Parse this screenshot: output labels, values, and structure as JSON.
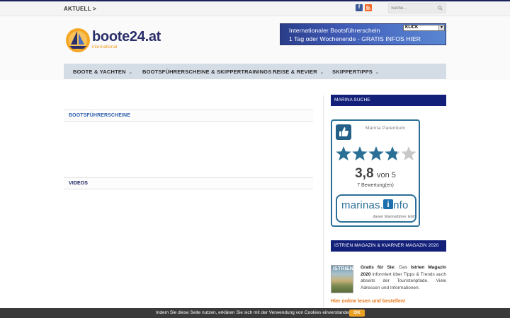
{
  "topbar": {
    "label": "AKTUELL >",
    "search_placeholder": "Suche...",
    "social": [
      {
        "icon": "facebook-icon",
        "glyph": "f",
        "color": "#3b5998"
      },
      {
        "icon": "rss-icon",
        "glyph": "∷",
        "color": "#f26522"
      }
    ]
  },
  "logo": {
    "title": "boote24.at",
    "subtitle": "international"
  },
  "banner": {
    "line1": "Internationaler Bootsführerschein",
    "line2": "1 Tag oder Wochenende - GRATIS INFOS HIER",
    "button": "KLICK"
  },
  "nav": {
    "items": [
      {
        "label": "BOOTE & YACHTEN"
      },
      {
        "label": "BOOTSFÜHRERSCHEINE & SKIPPERTRAININGS"
      },
      {
        "label": "REISE & REVIER"
      },
      {
        "label": "SKIPPERTIPPS"
      }
    ]
  },
  "main": {
    "sections": [
      {
        "title": "BOOTSFÜHRERSCHEINE",
        "color": "#2e5fae"
      },
      {
        "title": "VIDEOS",
        "color": "#1a2260"
      }
    ]
  },
  "sidebar": {
    "marina_title": "MARINA SUCHE",
    "widget": {
      "marina_name": "Marina Parentium",
      "rating": 3.8,
      "rating_display": "3,8",
      "rating_of": "von 5",
      "stars_max": 5,
      "reviews": "7 Bewertung(en)",
      "brand_text": "marinas.",
      "brand_letter": "i",
      "brand_suffix": "nfo",
      "brand_tagline": "dieser Marinaführer lebt!",
      "accent": "#2b6f98"
    },
    "magazine_title": "ISTRIEN MAGAZIN & KVARNER MAGAZIN 2020",
    "magazine": {
      "cover_label": "ISTRIEN",
      "lead": "Gratis für Sie:",
      "text1": " Das ",
      "bold2": "Istrien Magazin 2020",
      "text2": " informiert über Tipps & Trends auch abseits der Touristenpfade. Viele Adressen und Informationen.",
      "read_more": "Hier online lesen und bestellen!"
    }
  },
  "cookie": {
    "message": "Indem Sie diese Seite nutzen, erklären Sie sich mit der Verwendung von Cookies einverstanden.",
    "ok": "OK"
  }
}
